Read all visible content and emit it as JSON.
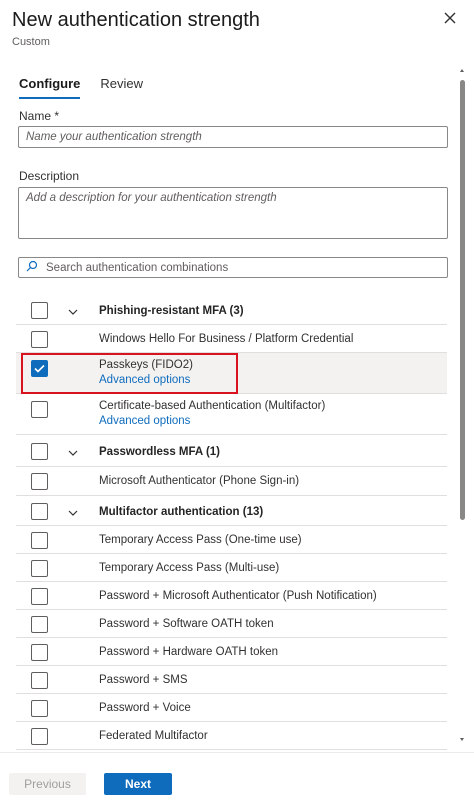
{
  "header": {
    "title": "New authentication strength",
    "subtitle": "Custom"
  },
  "tabs": [
    {
      "label": "Configure",
      "active": true
    },
    {
      "label": "Review",
      "active": false
    }
  ],
  "name_field": {
    "label": "Name *",
    "placeholder": "Name your authentication strength"
  },
  "description_field": {
    "label": "Description",
    "placeholder": "Add a description for your authentication strength"
  },
  "search": {
    "placeholder": "Search authentication combinations"
  },
  "list": [
    {
      "type": "group",
      "label": "Phishing-resistant MFA (3)",
      "checked": false
    },
    {
      "type": "item",
      "label": "Windows Hello For Business / Platform Credential",
      "checked": false
    },
    {
      "type": "item",
      "label": "Passkeys (FIDO2)",
      "checked": true,
      "link": "Advanced options"
    },
    {
      "type": "item",
      "label": "Certificate-based Authentication (Multifactor)",
      "checked": false,
      "link": "Advanced options"
    },
    {
      "type": "group",
      "label": "Passwordless MFA (1)",
      "checked": false
    },
    {
      "type": "item",
      "label": "Microsoft Authenticator (Phone Sign-in)",
      "checked": false
    },
    {
      "type": "group",
      "label": "Multifactor authentication (13)",
      "checked": false
    },
    {
      "type": "item",
      "label": "Temporary Access Pass (One-time use)",
      "checked": false
    },
    {
      "type": "item",
      "label": "Temporary Access Pass (Multi-use)",
      "checked": false
    },
    {
      "type": "item",
      "label": "Password + Microsoft Authenticator (Push Notification)",
      "checked": false
    },
    {
      "type": "item",
      "label": "Password + Software OATH token",
      "checked": false
    },
    {
      "type": "item",
      "label": "Password + Hardware OATH token",
      "checked": false
    },
    {
      "type": "item",
      "label": "Password + SMS",
      "checked": false
    },
    {
      "type": "item",
      "label": "Password + Voice",
      "checked": false
    },
    {
      "type": "item",
      "label": "Federated Multifactor",
      "checked": false
    }
  ],
  "footer": {
    "previous": "Previous",
    "next": "Next"
  },
  "colors": {
    "accent": "#0f6cbd",
    "highlight": "#d9121f"
  }
}
